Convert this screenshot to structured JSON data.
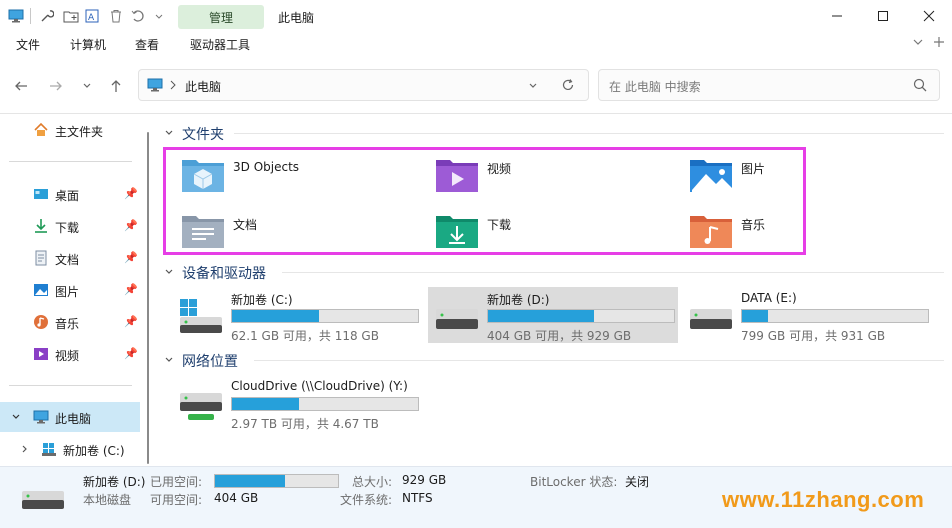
{
  "window": {
    "title": "此电脑",
    "context_tab": "管理"
  },
  "ribbon": {
    "tabs": [
      "文件",
      "计算机",
      "查看",
      "驱动器工具"
    ]
  },
  "address": {
    "location": "此电脑",
    "search_placeholder": "在 此电脑 中搜索"
  },
  "sidebar": {
    "home": "主文件夹",
    "pinned": [
      "桌面",
      "下载",
      "文档",
      "图片",
      "音乐",
      "视频"
    ],
    "this_pc": "此电脑",
    "this_pc_child": "新加卷 (C:)"
  },
  "sections": {
    "folders": "文件夹",
    "devices": "设备和驱动器",
    "network": "网络位置"
  },
  "folders": [
    {
      "name": "3D Objects",
      "icon": "3d-objects-folder-icon"
    },
    {
      "name": "视频",
      "icon": "videos-folder-icon"
    },
    {
      "name": "图片",
      "icon": "pictures-folder-icon"
    },
    {
      "name": "文档",
      "icon": "documents-folder-icon"
    },
    {
      "name": "下载",
      "icon": "downloads-folder-icon"
    },
    {
      "name": "音乐",
      "icon": "music-folder-icon"
    }
  ],
  "drives": [
    {
      "name": "新加卷 (C:)",
      "size": "62.1 GB 可用，共 118 GB",
      "used_fraction": 0.47
    },
    {
      "name": "新加卷 (D:)",
      "size": "404 GB 可用，共 929 GB",
      "used_fraction": 0.57
    },
    {
      "name": "DATA (E:)",
      "size": "799 GB 可用，共 931 GB",
      "used_fraction": 0.14
    }
  ],
  "network": [
    {
      "name": "CloudDrive (\\\\CloudDrive) (Y:)",
      "size": "2.97 TB 可用，共 4.67 TB",
      "used_fraction": 0.36
    }
  ],
  "details": {
    "name": "新加卷 (D:)",
    "type": "本地磁盘",
    "used_label": "已用空间:",
    "free_label": "可用空间:",
    "free_value": "404 GB",
    "total_label": "总大小:",
    "total_value": "929 GB",
    "fs_label": "文件系统:",
    "fs_value": "NTFS",
    "bitlocker_label": "BitLocker 状态:",
    "bitlocker_value": "关闭",
    "used_fraction": 0.57
  },
  "watermark": "www.11zhang.com",
  "colors": {
    "accent": "#26a0da",
    "highlight": "#e63ee6",
    "watermark": "#f19a1a"
  }
}
